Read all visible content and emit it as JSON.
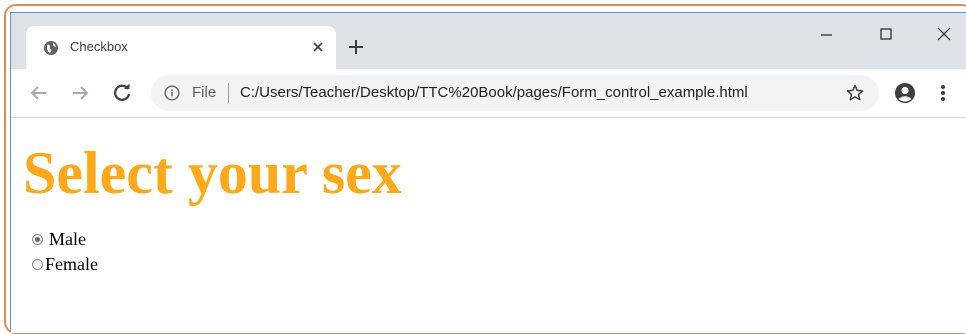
{
  "tab": {
    "title": "Checkbox",
    "favicon": "globe-icon",
    "close_icon": "close-icon",
    "new_tab_icon": "plus-icon"
  },
  "window_controls": {
    "minimize": "minimize-icon",
    "maximize": "maximize-icon",
    "close": "close-icon"
  },
  "toolbar": {
    "back_icon": "arrow-left-icon",
    "forward_icon": "arrow-right-icon",
    "reload_icon": "reload-icon",
    "site_info_icon": "info-icon",
    "scheme_label": "File",
    "url": "C:/Users/Teacher/Desktop/TTC%20Book/pages/Form_control_example.html",
    "bookmark_icon": "star-icon",
    "profile_icon": "account-icon",
    "menu_icon": "kebab-menu-icon"
  },
  "page": {
    "heading": "Select your sex",
    "heading_color": "#ffa91a",
    "radios": [
      {
        "label": "Male",
        "checked": true
      },
      {
        "label": "Female",
        "checked": false
      }
    ]
  },
  "colors": {
    "tabstrip": "#dee1e6",
    "omnibox": "#f1f3f4",
    "frame_accent": "#e08a5a"
  }
}
